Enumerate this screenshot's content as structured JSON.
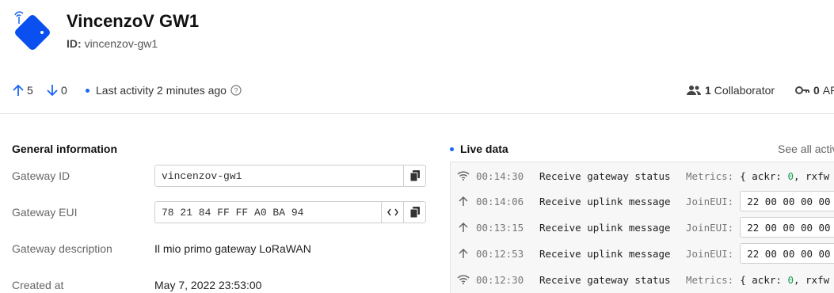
{
  "gateway": {
    "name": "VincenzoV GW1",
    "id_label": "ID:",
    "id_value": "vincenzov-gw1"
  },
  "stats": {
    "up_count": "5",
    "down_count": "0",
    "last_activity": "Last activity 2 minutes ago",
    "collaborators_count": "1",
    "collaborators_label": "Collaborator",
    "api_keys_count": "0",
    "api_keys_label": "AP"
  },
  "general": {
    "title": "General information",
    "gateway_id_label": "Gateway ID",
    "gateway_id_value": "vincenzov-gw1",
    "gateway_eui_label": "Gateway EUI",
    "gateway_eui_value": "78 21 84 FF FF A0 BA 94",
    "description_label": "Gateway description",
    "description_value": "Il mio primo gateway LoRaWAN",
    "created_label": "Created at",
    "created_value": "May 7, 2022 23:53:00"
  },
  "live": {
    "title": "Live data",
    "see_all": "See all activ",
    "rows": [
      {
        "icon": "wifi-icon",
        "time": "00:14:30",
        "type": "Receive gateway status",
        "key": "Metrics:",
        "text": "{ ackr: ",
        "num": "0",
        "text2": ", rxfw"
      },
      {
        "icon": "arrow-up-icon",
        "time": "00:14:06",
        "type": "Receive uplink message",
        "key": "JoinEUI:",
        "box": "22 00 00 00 00 0"
      },
      {
        "icon": "arrow-up-icon",
        "time": "00:13:15",
        "type": "Receive uplink message",
        "key": "JoinEUI:",
        "box": "22 00 00 00 00 0"
      },
      {
        "icon": "arrow-up-icon",
        "time": "00:12:53",
        "type": "Receive uplink message",
        "key": "JoinEUI:",
        "box": "22 00 00 00 00 0"
      },
      {
        "icon": "wifi-icon",
        "time": "00:12:30",
        "type": "Receive gateway status",
        "key": "Metrics:",
        "text": "{ ackr: ",
        "num": "0",
        "text2": ", rxfw"
      }
    ]
  },
  "colors": {
    "accent": "#1967f3",
    "icon_blue": "#0a4ff0",
    "green": "#1a9e4a"
  }
}
